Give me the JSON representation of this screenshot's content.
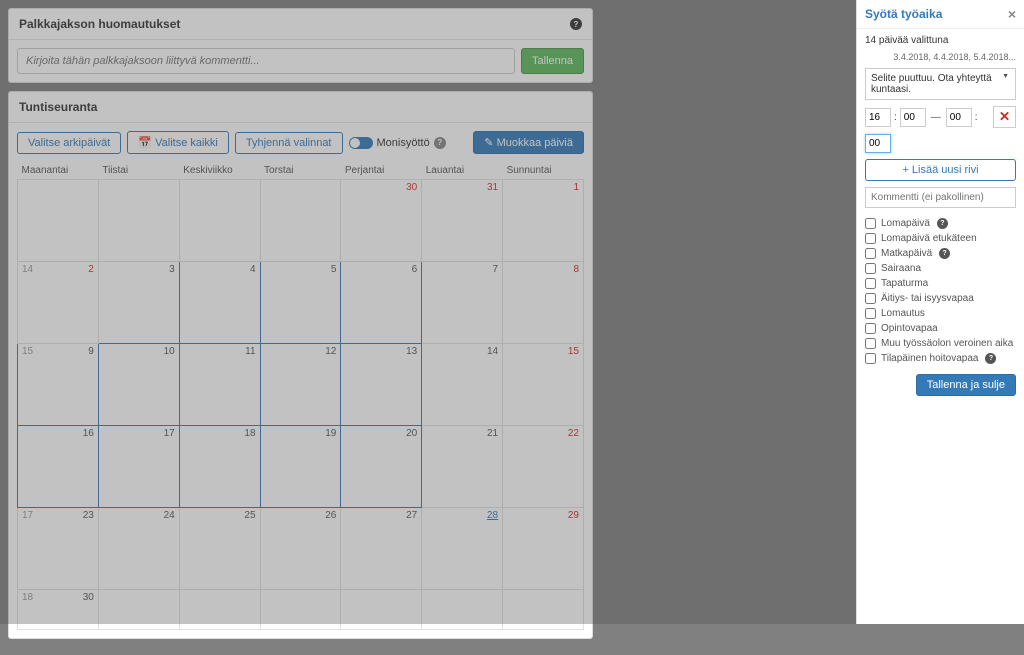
{
  "panel1": {
    "title": "Palkkajakson huomautukset",
    "placeholder": "Kirjoita tähän palkkajaksoon liittyvä kommentti...",
    "save": "Tallenna"
  },
  "panel2": {
    "title": "Tuntiseuranta"
  },
  "toolbar": {
    "b1": "Valitse arkipäivät",
    "b2": "Valitse kaikki",
    "b3": "Tyhjennä valinnat",
    "switch": "Monisyöttö",
    "edit": "Muokkaa päiviä"
  },
  "days": [
    "Maanantai",
    "Tiistai",
    "Keskiviikko",
    "Torstai",
    "Perjantai",
    "Lauantai",
    "Sunnuntai"
  ],
  "weeks": [
    {
      "wk": "",
      "cells": [
        {
          "n": "",
          "cls": ""
        },
        {
          "n": "",
          "cls": ""
        },
        {
          "n": "",
          "cls": ""
        },
        {
          "n": "",
          "cls": ""
        },
        {
          "n": "30",
          "cls": "red"
        },
        {
          "n": "31",
          "cls": "red"
        },
        {
          "n": "1",
          "cls": "red"
        }
      ]
    },
    {
      "wk": "14",
      "cells": [
        {
          "n": "2",
          "cls": "red"
        },
        {
          "n": "3",
          "cls": "",
          "sel": true
        },
        {
          "n": "4",
          "cls": "",
          "sel": true
        },
        {
          "n": "5",
          "cls": "",
          "sel": true
        },
        {
          "n": "6",
          "cls": "",
          "sel": true
        },
        {
          "n": "7",
          "cls": ""
        },
        {
          "n": "8",
          "cls": "red"
        }
      ]
    },
    {
      "wk": "15",
      "cells": [
        {
          "n": "9",
          "cls": "",
          "sel": true
        },
        {
          "n": "10",
          "cls": "",
          "sel": true
        },
        {
          "n": "11",
          "cls": "",
          "sel": true
        },
        {
          "n": "12",
          "cls": "",
          "sel": true
        },
        {
          "n": "13",
          "cls": "",
          "sel": true
        },
        {
          "n": "14",
          "cls": ""
        },
        {
          "n": "15",
          "cls": "red"
        }
      ]
    },
    {
      "wk": "",
      "cells": [
        {
          "n": "16",
          "cls": "",
          "sel": true
        },
        {
          "n": "17",
          "cls": "",
          "sel": true
        },
        {
          "n": "18",
          "cls": "",
          "sel": true
        },
        {
          "n": "19",
          "cls": "",
          "sel": true
        },
        {
          "n": "20",
          "cls": "",
          "sel": true
        },
        {
          "n": "21",
          "cls": ""
        },
        {
          "n": "22",
          "cls": "red"
        }
      ]
    },
    {
      "wk": "17",
      "cells": [
        {
          "n": "23",
          "cls": ""
        },
        {
          "n": "24",
          "cls": ""
        },
        {
          "n": "25",
          "cls": ""
        },
        {
          "n": "26",
          "cls": ""
        },
        {
          "n": "27",
          "cls": ""
        },
        {
          "n": "28",
          "cls": "blue"
        },
        {
          "n": "29",
          "cls": "red"
        }
      ]
    },
    {
      "wk": "18",
      "cells": [
        {
          "n": "30",
          "cls": ""
        },
        {
          "n": "",
          "cls": ""
        },
        {
          "n": "",
          "cls": ""
        },
        {
          "n": "",
          "cls": ""
        },
        {
          "n": "",
          "cls": ""
        },
        {
          "n": "",
          "cls": ""
        },
        {
          "n": "",
          "cls": ""
        }
      ],
      "short": true
    }
  ],
  "drawer": {
    "title": "Syötä työaika",
    "count": "14 päivää valittuna",
    "dates": "3.4.2018, 4.4.2018, 5.4.2018...",
    "select": "Selite puuttuu. Ota yhteyttä kuntaasi.",
    "t1": "16",
    "t2": "00",
    "t3": "00",
    "t4": "00",
    "addrow": "+ Lisää uusi rivi",
    "comment_ph": "Kommentti (ei pakollinen)",
    "checks": [
      "Lomapäivä",
      "Lomapäivä etukäteen",
      "Matkapäivä",
      "Sairaana",
      "Tapaturma",
      "Äitiys- tai isyysvapaa",
      "Lomautus",
      "Opintovapaa",
      "Muu työssäolon veroinen aika",
      "Tilapäinen hoitovapaa"
    ],
    "qmarks": {
      "0": true,
      "2": true,
      "9": true
    },
    "save": "Tallenna ja sulje"
  }
}
